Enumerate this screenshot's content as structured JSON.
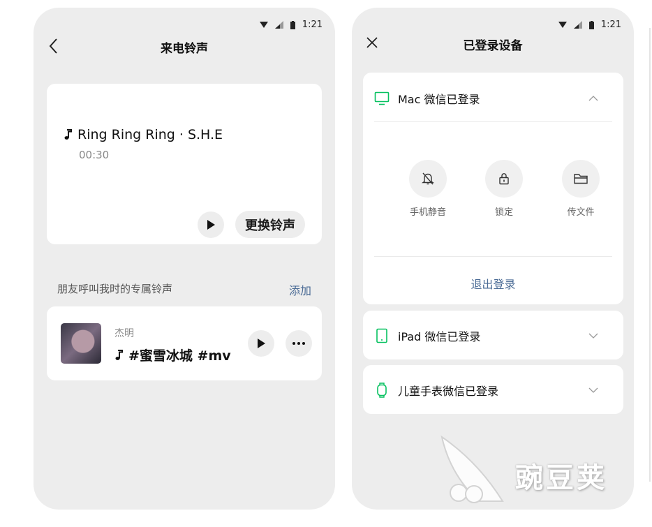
{
  "status_bar": {
    "time": "1:21"
  },
  "left": {
    "nav_title": "来电铃声",
    "ringtone": {
      "title": "Ring Ring Ring · S.H.E",
      "duration": "00:30",
      "change_label": "更换铃声"
    },
    "friends_section": {
      "label": "朋友呼叫我时的专属铃声",
      "add_label": "添加"
    },
    "friend": {
      "name": "杰明",
      "song": "#蜜雪冰城 #mv"
    }
  },
  "right": {
    "nav_title": "已登录设备",
    "mac": {
      "label": "Mac 微信已登录",
      "actions": [
        {
          "label": "手机静音",
          "icon": "bell-off-icon"
        },
        {
          "label": "锁定",
          "icon": "lock-icon"
        },
        {
          "label": "传文件",
          "icon": "folder-icon"
        }
      ],
      "logout_label": "退出登录"
    },
    "ipad": {
      "label": "iPad 微信已登录"
    },
    "watch": {
      "label": "儿童手表微信已登录"
    }
  },
  "watermark": {
    "text": "豌豆荚"
  },
  "colors": {
    "background": "#ededed",
    "card": "#ffffff",
    "accent_green": "#07c160",
    "link_blue": "#4a6b95"
  }
}
